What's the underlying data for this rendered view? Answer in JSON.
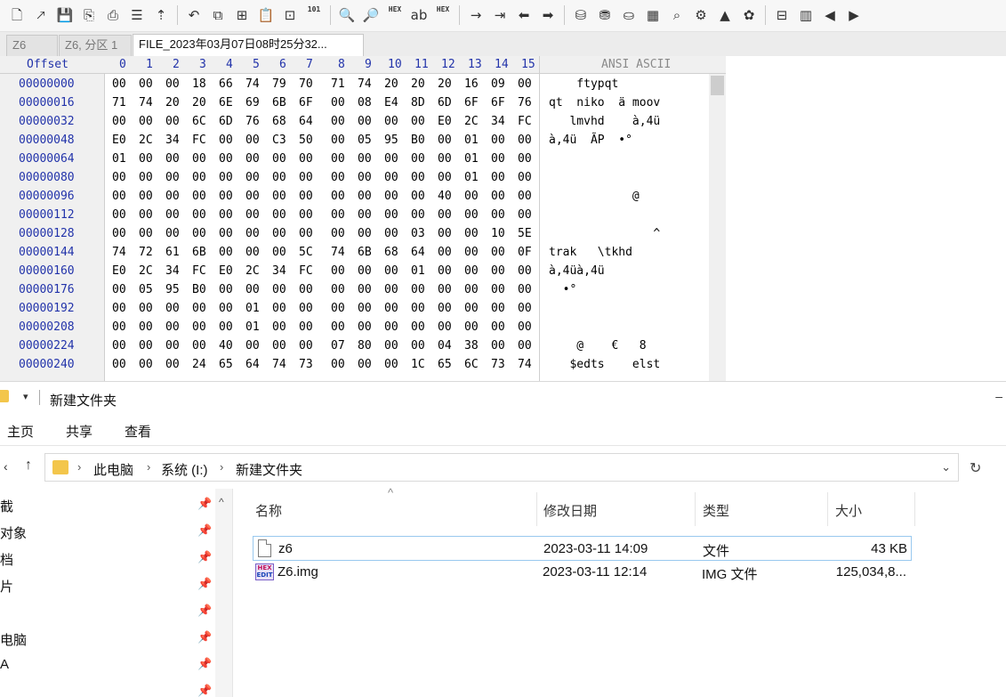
{
  "hex_editor": {
    "toolbar_icons": [
      {
        "name": "new-file-icon",
        "glyph": "🗋"
      },
      {
        "name": "open-file-icon",
        "glyph": "🡕"
      },
      {
        "name": "save-icon",
        "glyph": "💾"
      },
      {
        "name": "save-all-icon",
        "glyph": "⎘"
      },
      {
        "name": "print-icon",
        "glyph": "⎙"
      },
      {
        "name": "properties-icon",
        "glyph": "☰"
      },
      {
        "name": "run-icon",
        "glyph": "⇡"
      },
      {
        "name": "undo-icon",
        "glyph": "↶"
      },
      {
        "name": "copy-icon",
        "glyph": "⧉"
      },
      {
        "name": "copy-block-icon",
        "glyph": "⊞"
      },
      {
        "name": "paste-icon",
        "glyph": "📋"
      },
      {
        "name": "paste-write-icon",
        "glyph": "⊡"
      },
      {
        "name": "binary-icon",
        "glyph": "101"
      },
      {
        "name": "find-icon",
        "glyph": "🔍"
      },
      {
        "name": "find-next-icon",
        "glyph": "🔎"
      },
      {
        "name": "find-hex-icon",
        "glyph": "HEX"
      },
      {
        "name": "replace-icon",
        "glyph": "ab"
      },
      {
        "name": "replace-hex-icon",
        "glyph": "HEX"
      },
      {
        "name": "goto-offset-icon",
        "glyph": "→"
      },
      {
        "name": "goto-sector-icon",
        "glyph": "⇥"
      },
      {
        "name": "back-icon",
        "glyph": "⬅"
      },
      {
        "name": "forward-icon",
        "glyph": "➡"
      },
      {
        "name": "disk-icon",
        "glyph": "⛁"
      },
      {
        "name": "disk-add-icon",
        "glyph": "⛃"
      },
      {
        "name": "disk-image-icon",
        "glyph": "⛀"
      },
      {
        "name": "ram-icon",
        "glyph": "▦"
      },
      {
        "name": "search-icon",
        "glyph": "⌕"
      },
      {
        "name": "tools-icon",
        "glyph": "⚙"
      },
      {
        "name": "chart-icon",
        "glyph": "▲"
      },
      {
        "name": "options-icon",
        "glyph": "✿"
      },
      {
        "name": "block-icon",
        "glyph": "⊟"
      },
      {
        "name": "layout-icon",
        "glyph": "▥"
      },
      {
        "name": "prev-icon",
        "glyph": "◀"
      },
      {
        "name": "next-icon",
        "glyph": "▶"
      }
    ],
    "tabs": [
      {
        "label": "Z6"
      },
      {
        "label": "Z6, 分区 1"
      },
      {
        "label": "FILE_2023年03月07日08时25分32..."
      }
    ],
    "header": {
      "offset": "Offset",
      "columns": [
        "0",
        "1",
        "2",
        "3",
        "4",
        "5",
        "6",
        "7",
        "8",
        "9",
        "10",
        "11",
        "12",
        "13",
        "14",
        "15"
      ],
      "ascii": "ANSI ASCII"
    },
    "rows": [
      {
        "offset": "00000000",
        "hex": [
          "00",
          "00",
          "00",
          "18",
          "66",
          "74",
          "79",
          "70",
          "71",
          "74",
          "20",
          "20",
          "20",
          "16",
          "09",
          "00"
        ],
        "ascii": "    ftypqt"
      },
      {
        "offset": "00000016",
        "hex": [
          "71",
          "74",
          "20",
          "20",
          "6E",
          "69",
          "6B",
          "6F",
          "00",
          "08",
          "E4",
          "8D",
          "6D",
          "6F",
          "6F",
          "76"
        ],
        "ascii": "qt  niko  ä moov"
      },
      {
        "offset": "00000032",
        "hex": [
          "00",
          "00",
          "00",
          "6C",
          "6D",
          "76",
          "68",
          "64",
          "00",
          "00",
          "00",
          "00",
          "E0",
          "2C",
          "34",
          "FC"
        ],
        "ascii": "   lmvhd    à,4ü"
      },
      {
        "offset": "00000048",
        "hex": [
          "E0",
          "2C",
          "34",
          "FC",
          "00",
          "00",
          "C3",
          "50",
          "00",
          "05",
          "95",
          "B0",
          "00",
          "01",
          "00",
          "00"
        ],
        "ascii": "à,4ü  ÃP  •°"
      },
      {
        "offset": "00000064",
        "hex": [
          "01",
          "00",
          "00",
          "00",
          "00",
          "00",
          "00",
          "00",
          "00",
          "00",
          "00",
          "00",
          "00",
          "01",
          "00",
          "00"
        ],
        "ascii": ""
      },
      {
        "offset": "00000080",
        "hex": [
          "00",
          "00",
          "00",
          "00",
          "00",
          "00",
          "00",
          "00",
          "00",
          "00",
          "00",
          "00",
          "00",
          "01",
          "00",
          "00"
        ],
        "ascii": ""
      },
      {
        "offset": "00000096",
        "hex": [
          "00",
          "00",
          "00",
          "00",
          "00",
          "00",
          "00",
          "00",
          "00",
          "00",
          "00",
          "00",
          "40",
          "00",
          "00",
          "00"
        ],
        "ascii": "            @"
      },
      {
        "offset": "00000112",
        "hex": [
          "00",
          "00",
          "00",
          "00",
          "00",
          "00",
          "00",
          "00",
          "00",
          "00",
          "00",
          "00",
          "00",
          "00",
          "00",
          "00"
        ],
        "ascii": ""
      },
      {
        "offset": "00000128",
        "hex": [
          "00",
          "00",
          "00",
          "00",
          "00",
          "00",
          "00",
          "00",
          "00",
          "00",
          "00",
          "03",
          "00",
          "00",
          "10",
          "5E"
        ],
        "ascii": "               ^"
      },
      {
        "offset": "00000144",
        "hex": [
          "74",
          "72",
          "61",
          "6B",
          "00",
          "00",
          "00",
          "5C",
          "74",
          "6B",
          "68",
          "64",
          "00",
          "00",
          "00",
          "0F"
        ],
        "ascii": "trak   \\tkhd"
      },
      {
        "offset": "00000160",
        "hex": [
          "E0",
          "2C",
          "34",
          "FC",
          "E0",
          "2C",
          "34",
          "FC",
          "00",
          "00",
          "00",
          "01",
          "00",
          "00",
          "00",
          "00"
        ],
        "ascii": "à,4üà,4ü"
      },
      {
        "offset": "00000176",
        "hex": [
          "00",
          "05",
          "95",
          "B0",
          "00",
          "00",
          "00",
          "00",
          "00",
          "00",
          "00",
          "00",
          "00",
          "00",
          "00",
          "00"
        ],
        "ascii": "  •°"
      },
      {
        "offset": "00000192",
        "hex": [
          "00",
          "00",
          "00",
          "00",
          "00",
          "01",
          "00",
          "00",
          "00",
          "00",
          "00",
          "00",
          "00",
          "00",
          "00",
          "00"
        ],
        "ascii": ""
      },
      {
        "offset": "00000208",
        "hex": [
          "00",
          "00",
          "00",
          "00",
          "00",
          "01",
          "00",
          "00",
          "00",
          "00",
          "00",
          "00",
          "00",
          "00",
          "00",
          "00"
        ],
        "ascii": ""
      },
      {
        "offset": "00000224",
        "hex": [
          "00",
          "00",
          "00",
          "00",
          "40",
          "00",
          "00",
          "00",
          "07",
          "80",
          "00",
          "00",
          "04",
          "38",
          "00",
          "00"
        ],
        "ascii": "    @    €   8"
      },
      {
        "offset": "00000240",
        "hex": [
          "00",
          "00",
          "00",
          "24",
          "65",
          "64",
          "74",
          "73",
          "00",
          "00",
          "00",
          "1C",
          "65",
          "6C",
          "73",
          "74"
        ],
        "ascii": "   $edts    elst"
      }
    ]
  },
  "explorer": {
    "title": "新建文件夹",
    "title_dropdown": "▾",
    "title_control": "–",
    "ribbon_tabs": [
      "主页",
      "共享",
      "查看"
    ],
    "nav": {
      "back": "‹",
      "up": "↑"
    },
    "breadcrumb": [
      "此电脑",
      "系统 (I:)",
      "新建文件夹"
    ],
    "breadcrumb_sep": "›",
    "address_dropdown": "⌄",
    "refresh": "↻",
    "sort_indicator": "^",
    "nav_items": [
      {
        "label": "截"
      },
      {
        "label": "对象"
      },
      {
        "label": "档"
      },
      {
        "label": "片"
      },
      {
        "label": ""
      },
      {
        "label": "电脑"
      },
      {
        "label": "A"
      },
      {
        "label": ""
      }
    ],
    "pin_glyph": "📌",
    "nav_scroll_up": "^",
    "columns": {
      "name": "名称",
      "modified": "修改日期",
      "type": "类型",
      "size": "大小"
    },
    "files": [
      {
        "name": "z6",
        "modified": "2023-03-11 14:09",
        "type": "文件",
        "size": "43 KB",
        "icon": "document-icon"
      },
      {
        "name": "Z6.img",
        "modified": "2023-03-11 12:14",
        "type": "IMG 文件",
        "size": "125,034,8...",
        "icon": "hex-file-icon"
      }
    ],
    "hex_icon_text": {
      "top": "HEX",
      "bottom": "EDIT"
    }
  }
}
